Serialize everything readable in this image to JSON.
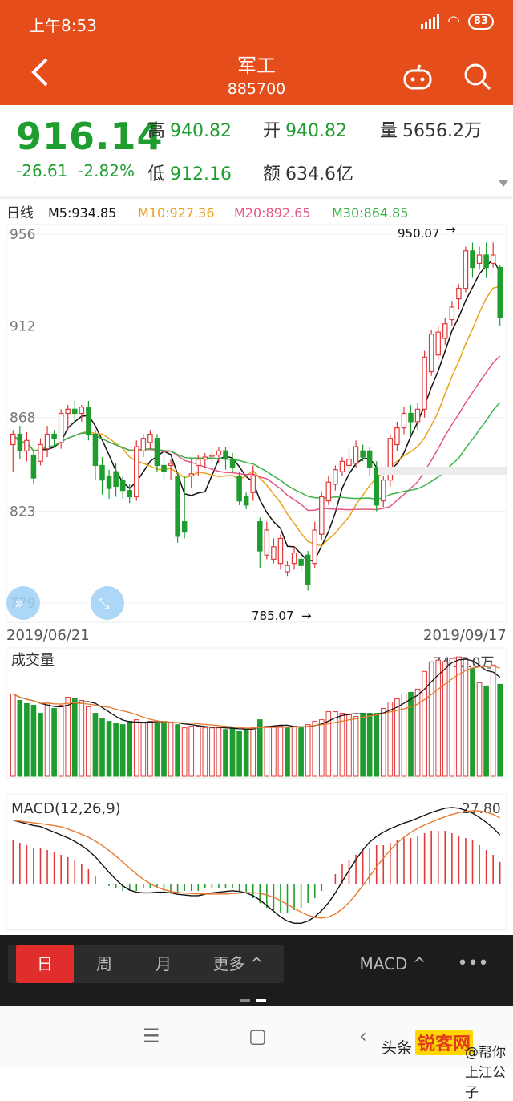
{
  "status": {
    "time": "上午8:53",
    "battery": "83"
  },
  "header": {
    "title": "军工",
    "code": "885700"
  },
  "quote": {
    "price": "916.14",
    "change": "-26.61",
    "change_pct": "-2.82%",
    "high_label": "高",
    "high": "940.82",
    "open_label": "开",
    "open": "940.82",
    "volume_label": "量",
    "volume": "5656.2万",
    "low_label": "低",
    "low": "912.16",
    "amount_label": "额",
    "amount": "634.6亿"
  },
  "colors": {
    "header": "#e54d1b",
    "down": "#1f9d2e",
    "up": "#e2383a",
    "m5": "#111111",
    "m10": "#e8a317",
    "m20": "#e4577f",
    "m30": "#3cb34a"
  },
  "chart_data": [
    {
      "type": "candlestick",
      "title": "日线",
      "legend": [
        {
          "name": "M5",
          "value": "M5:934.85",
          "color": "#111111"
        },
        {
          "name": "M10",
          "value": "M10:927.36",
          "color": "#e8a317"
        },
        {
          "name": "M20",
          "value": "M20:892.65",
          "color": "#e4577f"
        },
        {
          "name": "M30",
          "value": "M30:864.85",
          "color": "#3cb34a"
        }
      ],
      "y_ticks": [
        "956",
        "912",
        "868",
        "823",
        "779"
      ],
      "ylim": [
        779,
        956
      ],
      "x_start": "2019/06/21",
      "x_end": "2019/09/17",
      "annotations": [
        "950.07",
        "785.07"
      ],
      "candles": [
        [
          855,
          860,
          842,
          862
        ],
        [
          860,
          852,
          848,
          864
        ],
        [
          852,
          857,
          847,
          861
        ],
        [
          850,
          839,
          836,
          852
        ],
        [
          847,
          855,
          845,
          858
        ],
        [
          853,
          860,
          849,
          864
        ],
        [
          860,
          858,
          854,
          862
        ],
        [
          856,
          870,
          853,
          872
        ],
        [
          870,
          872,
          862,
          874
        ],
        [
          872,
          870,
          865,
          876
        ],
        [
          870,
          873,
          866,
          874
        ],
        [
          873,
          860,
          857,
          876
        ],
        [
          860,
          845,
          838,
          862
        ],
        [
          845,
          838,
          831,
          849
        ],
        [
          840,
          834,
          829,
          843
        ],
        [
          842,
          835,
          830,
          846
        ],
        [
          838,
          833,
          829,
          840
        ],
        [
          833,
          830,
          827,
          836
        ],
        [
          830,
          854,
          828,
          857
        ],
        [
          852,
          858,
          849,
          860
        ],
        [
          856,
          860,
          853,
          862
        ],
        [
          858,
          845,
          842,
          860
        ],
        [
          845,
          842,
          838,
          850
        ],
        [
          845,
          846,
          838,
          848
        ],
        [
          840,
          811,
          808,
          842
        ],
        [
          818,
          813,
          810,
          840
        ],
        [
          840,
          841,
          834,
          848
        ],
        [
          845,
          848,
          840,
          850
        ],
        [
          848,
          849,
          844,
          851
        ],
        [
          850,
          850,
          846,
          852
        ],
        [
          850,
          852,
          846,
          854
        ],
        [
          852,
          848,
          843,
          854
        ],
        [
          848,
          844,
          842,
          851
        ],
        [
          840,
          828,
          826,
          842
        ],
        [
          830,
          826,
          824,
          832
        ],
        [
          832,
          840,
          828,
          845
        ],
        [
          818,
          804,
          796,
          820
        ],
        [
          802,
          814,
          800,
          818
        ],
        [
          800,
          806,
          798,
          810
        ],
        [
          798,
          810,
          795,
          812
        ],
        [
          794,
          797,
          792,
          799
        ],
        [
          798,
          803,
          795,
          806
        ],
        [
          800,
          797,
          794,
          802
        ],
        [
          802,
          788,
          785,
          804
        ],
        [
          798,
          814,
          796,
          818
        ],
        [
          812,
          830,
          809,
          832
        ],
        [
          828,
          837,
          826,
          840
        ],
        [
          836,
          843,
          833,
          845
        ],
        [
          842,
          847,
          840,
          849
        ],
        [
          845,
          848,
          842,
          853
        ],
        [
          846,
          854,
          844,
          857
        ],
        [
          852,
          849,
          847,
          855
        ],
        [
          852,
          844,
          840,
          854
        ],
        [
          844,
          826,
          823,
          847
        ],
        [
          828,
          838,
          825,
          840
        ],
        [
          838,
          858,
          835,
          860
        ],
        [
          855,
          863,
          852,
          866
        ],
        [
          863,
          870,
          860,
          873
        ],
        [
          870,
          866,
          860,
          874
        ],
        [
          866,
          872,
          862,
          875
        ],
        [
          872,
          897,
          868,
          900
        ],
        [
          890,
          908,
          888,
          910
        ],
        [
          898,
          909,
          896,
          912
        ],
        [
          906,
          913,
          903,
          916
        ],
        [
          915,
          921,
          912,
          924
        ],
        [
          925,
          930,
          920,
          932
        ],
        [
          930,
          948,
          928,
          950
        ],
        [
          948,
          940,
          935,
          952
        ],
        [
          942,
          946,
          939,
          950
        ],
        [
          946,
          940,
          935,
          952
        ],
        [
          942,
          946,
          940,
          952
        ],
        [
          940,
          916,
          912,
          941
        ]
      ]
    },
    {
      "type": "bar",
      "title": "成交量",
      "max_label": "7407.0万",
      "max_value": 7407,
      "values": [
        5100,
        4700,
        4500,
        4400,
        3900,
        4600,
        4200,
        4400,
        4900,
        4800,
        4700,
        4300,
        3900,
        3600,
        3400,
        3300,
        3200,
        3400,
        3500,
        3300,
        3400,
        3300,
        3400,
        3300,
        3200,
        3000,
        3100,
        3100,
        3000,
        3000,
        3000,
        2900,
        3000,
        2800,
        2900,
        3000,
        3500,
        3100,
        3100,
        3100,
        3000,
        3100,
        3000,
        3200,
        3400,
        3500,
        4000,
        4000,
        3900,
        3800,
        3700,
        3900,
        3900,
        3900,
        4200,
        4600,
        4800,
        5100,
        5200,
        5400,
        6500,
        7100,
        7200,
        7100,
        7300,
        7400,
        7300,
        6700,
        5800,
        5600,
        6900,
        5700
      ],
      "up": [
        1,
        0,
        0,
        0,
        0,
        1,
        0,
        1,
        1,
        0,
        1,
        1,
        0,
        0,
        0,
        0,
        0,
        0,
        1,
        1,
        1,
        0,
        0,
        1,
        0,
        1,
        1,
        1,
        1,
        1,
        1,
        0,
        0,
        0,
        0,
        1,
        0,
        1,
        1,
        1,
        0,
        1,
        0,
        1,
        1,
        1,
        1,
        1,
        1,
        1,
        1,
        0,
        0,
        0,
        1,
        1,
        1,
        1,
        0,
        1,
        1,
        1,
        1,
        1,
        1,
        1,
        1,
        0,
        1,
        0,
        1,
        0
      ]
    },
    {
      "type": "bar",
      "title": "MACD(12,26,9)",
      "last": "27.80",
      "values": [
        18,
        17,
        16,
        15,
        15,
        14,
        13,
        12,
        11,
        10,
        8,
        6,
        3,
        0,
        -1,
        -2,
        -3,
        -3,
        -3,
        -2,
        -2,
        -2,
        -3,
        -4,
        -4,
        -3,
        -3,
        -3,
        -2,
        -2,
        -2,
        -2,
        -2,
        -3,
        -4,
        -6,
        -8,
        -10,
        -11,
        -12,
        -12,
        -11,
        -10,
        -8,
        -6,
        -3,
        0,
        4,
        8,
        10,
        12,
        14,
        15,
        16,
        16,
        17,
        18,
        19,
        19,
        20,
        21,
        22,
        22,
        22,
        21,
        20,
        19,
        18,
        16,
        14,
        12,
        9
      ]
    }
  ],
  "toolbar": {
    "tabs": [
      "日",
      "周",
      "月",
      "更多 ^"
    ],
    "indicator": "MACD ^",
    "more": "•••"
  },
  "watermark": {
    "text1": "头条",
    "text2": "锐客网",
    "text3": "@帮你上江公子"
  }
}
